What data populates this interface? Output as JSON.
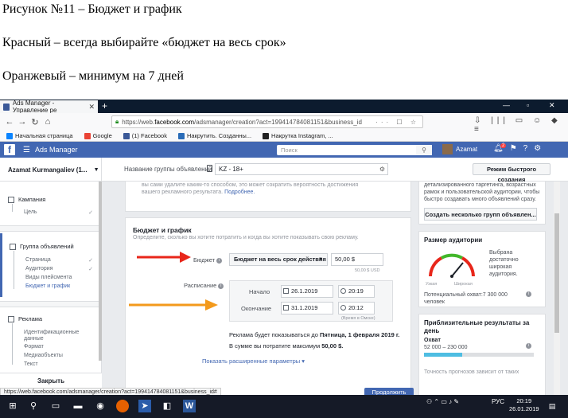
{
  "doc": {
    "line1": "Рисунок №11 – Бюджет и график",
    "line2": "Красный – всегда выбирайте «бюджет на весь срок»",
    "line3": "Оранжевый – минимум на 7 дней"
  },
  "browser": {
    "tab_title": "Ads Manager - Управление ре",
    "url_prefix": "https://web.",
    "url_host": "facebook.com",
    "url_rest": "/adsmanager/creation?act=199414784081151&business_id",
    "bookmarks": [
      {
        "label": "Начальная страница",
        "color": "#0a84ff"
      },
      {
        "label": "Google",
        "color": "#ea4335"
      },
      {
        "label": "(1) Facebook",
        "color": "#3b5998"
      },
      {
        "label": "Накрутить. Созданны...",
        "color": "#2a6cb8"
      },
      {
        "label": "Накрутка Instagram, ...",
        "color": "#222222"
      }
    ]
  },
  "fb": {
    "app_name": "Ads Manager",
    "search_placeholder": "Поиск",
    "user_name": "Azamat",
    "notif_count": "2"
  },
  "toolbar": {
    "account": "Azamat Kurmangaliev (1...",
    "adset_label": "Название группы объявлений",
    "adset_value": "KZ - 18+",
    "quick_mode": "Режим быстрого создания"
  },
  "sidebar": {
    "campaign": "Кампания",
    "goal": "Цель",
    "adset_group": "Группа объявлений",
    "adset_items": [
      "Страница",
      "Аудитория",
      "Виды плейсмента",
      "Бюджет и график"
    ],
    "ad_group": "Реклама",
    "ad_items": [
      "Идентификационные данные",
      "Формат",
      "Медиаобъекты",
      "Текст"
    ],
    "close": "Закрыть"
  },
  "main": {
    "top_text_1": "вы сами удалите каким-то способом, это может сократить вероятность достижения",
    "top_text_2": "вашего рекламного результата.",
    "top_link": "Подробнее.",
    "budget_title": "Бюджет и график",
    "budget_sub": "Определите, сколько вы хотите потратить и когда вы хотите показывать свою рекламу.",
    "budget_label": "Бюджет",
    "budget_type": "Бюджет на весь срок действия",
    "budget_value": "50,00 $",
    "currency_note": "50,00 $ USD",
    "schedule_label": "Расписание",
    "start_label": "Начало",
    "start_date": "26.1.2019",
    "start_time": "20:19",
    "end_label": "Окончание",
    "end_date": "31.1.2019",
    "end_time": "20:12",
    "tz_note": "(Время в Омске)",
    "run_text_prefix": "Реклама будет показываться до ",
    "run_text_bold": "Пятница, 1 февраля 2019 г.",
    "spend_text_prefix": "В сумме вы потратите максимум ",
    "spend_text_bold": "50,00 $.",
    "advanced": "Показать расширенные параметры"
  },
  "right": {
    "top_text": [
      "детализированного таргетинга, возрастных",
      "рамок и пользовательской аудитории, чтобы",
      "быстро создавать много объявлений сразу."
    ],
    "create_multi": "Создать несколько групп объявлен...",
    "audience_title": "Размер аудитории",
    "gauge_narrow": "Узкая",
    "gauge_wide": "Широкая",
    "gauge_level": 0.72,
    "audience_desc": [
      "Выбрана",
      "достаточно",
      "широкая",
      "аудитория."
    ],
    "potential": "Потенциальный охват:7 300 000",
    "people": "человек",
    "results_title": "Приблизительные результаты за",
    "results_title2": "день",
    "reach_label": "Охват",
    "reach_value": "52 000 – 230 000",
    "reach_fill": 0.35,
    "forecast_note": "Точность прогнозов зависит от таких"
  },
  "status": {
    "url": "https://web.facebook.com/adsmanager/creation?act=199414784081151&business_id#",
    "publish": "Продолжить"
  },
  "taskbar": {
    "lang": "РУС",
    "time": "20:19",
    "date": "26.01.2019",
    "notif": "6"
  },
  "colors": {
    "fb_blue": "#4267b2",
    "red_arrow": "#e8261a",
    "orange_arrow": "#f39a1c"
  }
}
